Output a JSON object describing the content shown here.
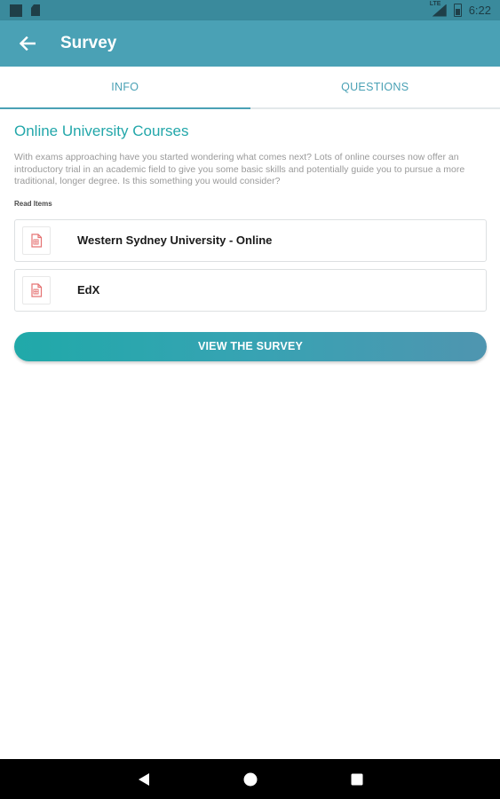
{
  "status_bar": {
    "network_label": "LTE",
    "time": "6:22"
  },
  "app_bar": {
    "title": "Survey",
    "back_icon": "arrow-left-icon"
  },
  "tabs": [
    {
      "label": "INFO",
      "active": true
    },
    {
      "label": "QUESTIONS",
      "active": false
    }
  ],
  "content": {
    "heading": "Online University Courses",
    "description": "With exams approaching have you started wondering what comes next? Lots of online courses now offer an introductory trial in an academic field to give you some basic skills and potentially guide you to pursue a more traditional, longer degree. Is this something you would consider?",
    "read_items_label": "Read Items",
    "read_items": [
      {
        "label": "Western Sydney University - Online",
        "icon": "document-icon"
      },
      {
        "label": "EdX",
        "icon": "document-icon"
      }
    ],
    "survey_button": "VIEW THE SURVEY"
  },
  "colors": {
    "status_bar": "#3a8a9c",
    "app_bar": "#4aa1b5",
    "accent": "#23a7aa",
    "doc_icon": "#e57373"
  }
}
